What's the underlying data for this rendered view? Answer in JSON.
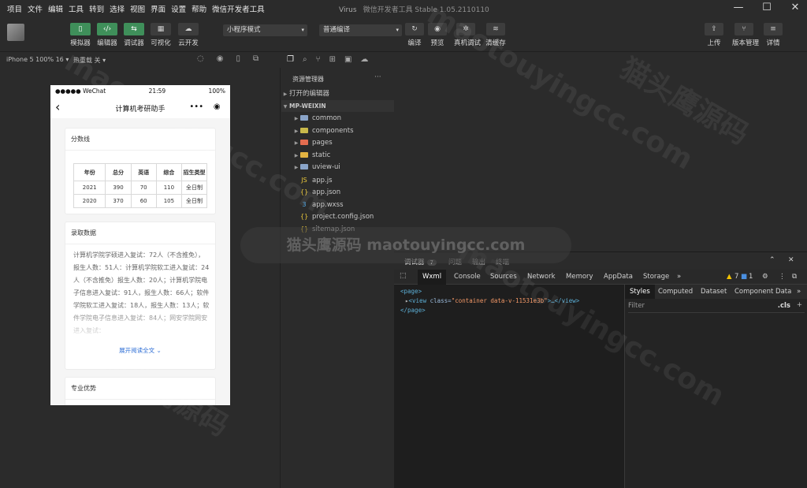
{
  "menu": [
    "项目",
    "文件",
    "编辑",
    "工具",
    "转到",
    "选择",
    "视图",
    "界面",
    "设置",
    "帮助",
    "微信开发者工具"
  ],
  "window": {
    "app": "Virus",
    "title": "微信开发者工具 Stable 1.05.2110110"
  },
  "toolbar": {
    "modes": [
      {
        "label": "模拟器",
        "icon": "phone-icon",
        "glyph": "▯"
      },
      {
        "label": "编辑器",
        "icon": "code-icon",
        "glyph": "‹/›"
      },
      {
        "label": "调试器",
        "icon": "debug-icon",
        "glyph": "⇆"
      }
    ],
    "extra": [
      {
        "label": "可视化",
        "icon": "layout-icon",
        "glyph": "▦"
      },
      {
        "label": "云开发",
        "icon": "cloud-icon",
        "glyph": "☁"
      }
    ],
    "mode_select": "小程序模式",
    "compile_select": "普通编译",
    "actions": [
      {
        "label": "编译",
        "icon": "refresh-icon",
        "glyph": "↻"
      },
      {
        "label": "预览",
        "icon": "eye-icon",
        "glyph": "◉"
      },
      {
        "label": "真机调试",
        "icon": "bug-icon",
        "glyph": "✲"
      },
      {
        "label": "清缓存",
        "icon": "layers-icon",
        "glyph": "≋"
      }
    ],
    "right": [
      {
        "label": "上传",
        "icon": "upload-icon",
        "glyph": "⇪"
      },
      {
        "label": "版本管理",
        "icon": "branch-icon",
        "glyph": "⑂"
      },
      {
        "label": "详情",
        "icon": "menu-icon",
        "glyph": "≡"
      }
    ]
  },
  "subbar": {
    "device": "iPhone 5 100% 16 ▾",
    "hotreload": "热重载 关 ▾"
  },
  "phone": {
    "status_left": "●●●●● WeChat",
    "time": "21:59",
    "battery": "100%",
    "nav_title": "计算机考研助手",
    "score_card": {
      "title": "分数线",
      "headers": [
        "年份",
        "总分",
        "英语",
        "综合",
        "招生类型"
      ],
      "rows": [
        [
          "2021",
          "390",
          "70",
          "110",
          "全日制"
        ],
        [
          "2020",
          "370",
          "60",
          "105",
          "全日制"
        ]
      ]
    },
    "admit_card": {
      "title": "录取数据",
      "text": "计算机学院学硕进入复试：72人（不含推免），报生人数：51人：计算机学院软工进入复试：24人（不含推免）报生人数：20人；计算机学院电子信息进入复试：91人，报生人数：66人；软件学院软工进入复试：18人，报生人数：13人；软件学院电子信息进入复试：84人；网安学院网安进入复试：",
      "expand": "展开阅读全文"
    },
    "next_title": "专业优势"
  },
  "explorer": {
    "header": "资源管理器",
    "open_editors": "打开的编辑器",
    "project": "MP-WEIXIN",
    "items": [
      {
        "name": "common",
        "kind": "folder",
        "color": "#8aa4c8"
      },
      {
        "name": "components",
        "kind": "folder",
        "color": "#c9b94b"
      },
      {
        "name": "pages",
        "kind": "folder",
        "color": "#e36c4f"
      },
      {
        "name": "static",
        "kind": "folder",
        "color": "#e3b341"
      },
      {
        "name": "uview-ui",
        "kind": "folder",
        "color": "#8aa4c8"
      },
      {
        "name": "app.js",
        "kind": "js",
        "glyph": "JS",
        "color": "#e8c63a"
      },
      {
        "name": "app.json",
        "kind": "json",
        "glyph": "{}",
        "color": "#e8c63a"
      },
      {
        "name": "app.wxss",
        "kind": "wxss",
        "glyph": "3",
        "color": "#4aa3e0"
      },
      {
        "name": "project.config.json",
        "kind": "json",
        "glyph": "{}",
        "color": "#e8c63a"
      },
      {
        "name": "sitemap.json",
        "kind": "json",
        "glyph": "{}",
        "color": "#e8c63a"
      }
    ]
  },
  "devtools": {
    "tabs": [
      {
        "label": "调试器",
        "badge": "7"
      },
      {
        "label": "问题"
      },
      {
        "label": "输出"
      },
      {
        "label": "终端"
      }
    ],
    "panels": [
      "Wxml",
      "Console",
      "Sources",
      "Network",
      "Memory",
      "AppData",
      "Storage"
    ],
    "warnings": "7",
    "infos": "1",
    "dom": {
      "open": "<page>",
      "tag_open": "<view",
      "attr": "class=",
      "value": "\"container data-v-11531e3b\"",
      "rest": ">…</view>",
      "close": "</page>"
    },
    "style_tabs": [
      "Styles",
      "Computed",
      "Dataset",
      "Component Data"
    ],
    "filter_placeholder": "Filter",
    "cls": ".cls"
  },
  "watermark": {
    "banner": "猫头鹰源码 maotouyingcc.com",
    "text": "maotouyingcc.com",
    "cn": "猫头鹰源码"
  }
}
